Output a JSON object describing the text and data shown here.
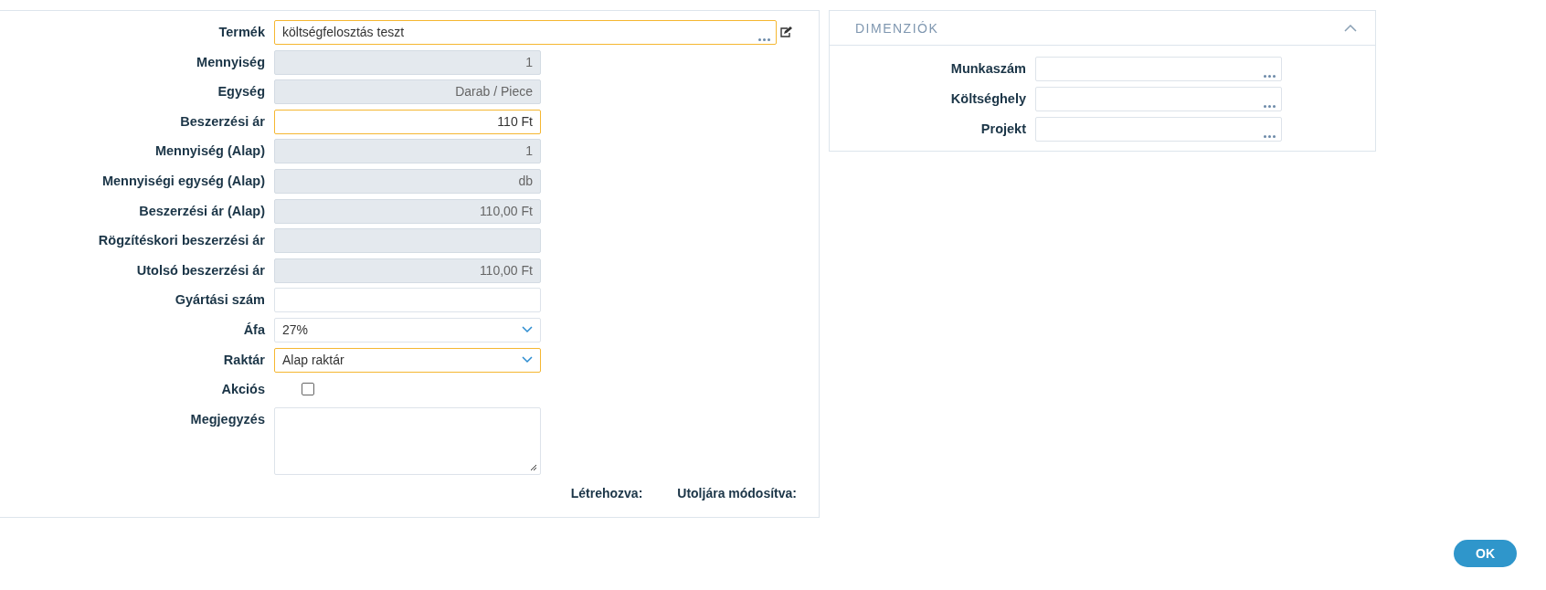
{
  "form": {
    "fields": [
      {
        "label": "Termék",
        "kind": "lookup",
        "value": "költségfelosztás teszt",
        "disabled": false,
        "highlighted": true,
        "editable": true
      },
      {
        "label": "Mennyiség",
        "kind": "number",
        "value": "1",
        "disabled": true,
        "highlighted": false
      },
      {
        "label": "Egység",
        "kind": "number",
        "value": "Darab / Piece",
        "disabled": true,
        "highlighted": false
      },
      {
        "label": "Beszerzési ár",
        "kind": "number",
        "value": "110 Ft",
        "disabled": false,
        "highlighted": true
      },
      {
        "label": "Mennyiség (Alap)",
        "kind": "number",
        "value": "1",
        "disabled": true,
        "highlighted": false
      },
      {
        "label": "Mennyiségi egység (Alap)",
        "kind": "number",
        "value": "db",
        "disabled": true,
        "highlighted": false
      },
      {
        "label": "Beszerzési ár (Alap)",
        "kind": "number",
        "value": "110,00 Ft",
        "disabled": true,
        "highlighted": false
      },
      {
        "label": "Rögzítéskori beszerzési ár",
        "kind": "number",
        "disabled": true,
        "highlighted": false
      },
      {
        "label": "Utolsó beszerzési ár",
        "kind": "number",
        "value": "110,00 Ft",
        "disabled": true,
        "highlighted": false
      },
      {
        "label": "Gyártási szám",
        "kind": "text",
        "disabled": false,
        "highlighted": false
      },
      {
        "label": "Áfa",
        "kind": "select",
        "value": "27%",
        "disabled": false,
        "highlighted": false
      },
      {
        "label": "Raktár",
        "kind": "select",
        "value": "Alap raktár",
        "disabled": false,
        "highlighted": true
      },
      {
        "label": "Akciós",
        "kind": "checkbox",
        "checked": false
      },
      {
        "label": "Megjegyzés",
        "kind": "textarea",
        "disabled": false,
        "highlighted": false
      }
    ],
    "footer": [
      "Létrehozva:",
      "Utoljára módosítva:"
    ]
  },
  "dimensions": {
    "title": "DIMENZIÓK",
    "expanded": true,
    "fields": [
      {
        "label": "Munkaszám",
        "kind": "lookup"
      },
      {
        "label": "Költséghely",
        "kind": "lookup"
      },
      {
        "label": "Projekt",
        "kind": "lookup"
      }
    ]
  },
  "buttons": [
    "OK"
  ]
}
